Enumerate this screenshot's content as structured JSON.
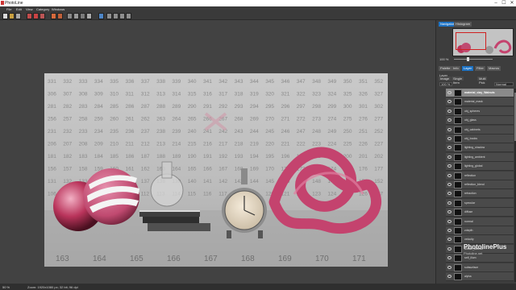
{
  "titlebar": {
    "title": "PhotoLine",
    "minimize": "–",
    "maximize": "☐",
    "close": "✕"
  },
  "menubar": {
    "items": [
      "File",
      "Edit",
      "View",
      "Category",
      "Windows"
    ]
  },
  "toolbar": {
    "buttons": [
      "new",
      "open",
      "save",
      "print",
      "copy",
      "cut",
      "paste",
      "tools",
      "brush",
      "select",
      "crop",
      "zoom"
    ]
  },
  "canvas": {
    "numbers": [
      [
        "331",
        "332",
        "333",
        "334",
        "335",
        "336",
        "337",
        "338",
        "339",
        "340",
        "341",
        "342",
        "343",
        "344",
        "345",
        "346",
        "347",
        "348",
        "349",
        "350",
        "351",
        "352"
      ],
      [
        "306",
        "307",
        "308",
        "309",
        "310",
        "311",
        "312",
        "313",
        "314",
        "315",
        "316",
        "317",
        "318",
        "319",
        "320",
        "321",
        "322",
        "323",
        "324",
        "325",
        "326",
        "327"
      ],
      [
        "281",
        "282",
        "283",
        "284",
        "285",
        "286",
        "287",
        "288",
        "289",
        "290",
        "291",
        "292",
        "293",
        "294",
        "295",
        "296",
        "297",
        "298",
        "299",
        "300",
        "301",
        "302"
      ],
      [
        "256",
        "257",
        "258",
        "259",
        "260",
        "261",
        "262",
        "263",
        "264",
        "265",
        "266",
        "267",
        "268",
        "269",
        "270",
        "271",
        "272",
        "273",
        "274",
        "275",
        "276",
        "277"
      ],
      [
        "231",
        "232",
        "233",
        "234",
        "235",
        "236",
        "237",
        "238",
        "239",
        "240",
        "241",
        "242",
        "243",
        "244",
        "245",
        "246",
        "247",
        "248",
        "249",
        "250",
        "251",
        "252"
      ],
      [
        "206",
        "207",
        "208",
        "209",
        "210",
        "211",
        "212",
        "213",
        "214",
        "215",
        "216",
        "217",
        "218",
        "219",
        "220",
        "221",
        "222",
        "223",
        "224",
        "225",
        "226",
        "227"
      ],
      [
        "181",
        "182",
        "183",
        "184",
        "185",
        "186",
        "187",
        "188",
        "189",
        "190",
        "191",
        "192",
        "193",
        "194",
        "195",
        "196",
        "197",
        "198",
        "199",
        "200",
        "201",
        "202"
      ],
      [
        "156",
        "157",
        "158",
        "159",
        "160",
        "161",
        "162",
        "163",
        "164",
        "165",
        "166",
        "167",
        "168",
        "169",
        "170",
        "171",
        "172",
        "173",
        "174",
        "175",
        "176",
        "177"
      ],
      [
        "131",
        "132",
        "133",
        "134",
        "135",
        "136",
        "137",
        "138",
        "139",
        "140",
        "141",
        "142",
        "143",
        "144",
        "145",
        "146",
        "147",
        "148",
        "149",
        "150",
        "151",
        "152"
      ],
      [
        "106",
        "107",
        "108",
        "109",
        "110",
        "111",
        "112",
        "113",
        "114",
        "115",
        "116",
        "117",
        "118",
        "119",
        "120",
        "121",
        "122",
        "123",
        "124",
        "125",
        "126",
        "127"
      ]
    ],
    "floor_numbers": [
      "163",
      "164",
      "165",
      "166",
      "167",
      "168",
      "169",
      "170",
      "171"
    ]
  },
  "statusbar": {
    "zoom": "50 %",
    "info": "Zoom: 1920x1080 px; 32 bit; 96 dpi"
  },
  "right_panel": {
    "nav_tabs": [
      "Navigator",
      "Histogram"
    ],
    "nav_zoom": "100 %",
    "panel_tabs": [
      "Palette",
      "Info",
      "Layer",
      "Filter",
      "Macros"
    ],
    "layer_label": "Layer",
    "sub_tabs": [
      "Image",
      "Single Item",
      "Multi Pick"
    ],
    "opacity": "100 %",
    "blend": "Normal",
    "layers": [
      {
        "name": "material_clay_Walnuts",
        "selected": true
      },
      {
        "name": "material_mask",
        "selected": false
      },
      {
        "name": "obj_spheres",
        "selected": false
      },
      {
        "name": "obj_glass",
        "selected": false
      },
      {
        "name": "obj_cabinets",
        "selected": false
      },
      {
        "name": "obj_books",
        "selected": false
      },
      {
        "name": "lighting_shadow",
        "selected": false
      },
      {
        "name": "lighting_ambient",
        "selected": false
      },
      {
        "name": "lighting_global",
        "selected": false
      },
      {
        "name": "reflection",
        "selected": false
      },
      {
        "name": "reflection_blend",
        "selected": false
      },
      {
        "name": "refraction",
        "selected": false
      },
      {
        "name": "specular",
        "selected": false
      },
      {
        "name": "diffuse",
        "selected": false
      },
      {
        "name": "normal",
        "selected": false
      },
      {
        "name": "zdepth",
        "selected": false
      },
      {
        "name": "velocity",
        "selected": false
      },
      {
        "name": "diffuse_albedo",
        "selected": false
      },
      {
        "name": "self_illum",
        "selected": false
      },
      {
        "name": "subsurface",
        "selected": false
      },
      {
        "name": "alpha",
        "selected": false
      }
    ],
    "watermark": "PhotolinePlus",
    "watermark_sub": "Photoline.net"
  },
  "colors": {
    "accent": "#1e73c4",
    "pink": "#c4436e",
    "background": "#3c3c3c"
  }
}
